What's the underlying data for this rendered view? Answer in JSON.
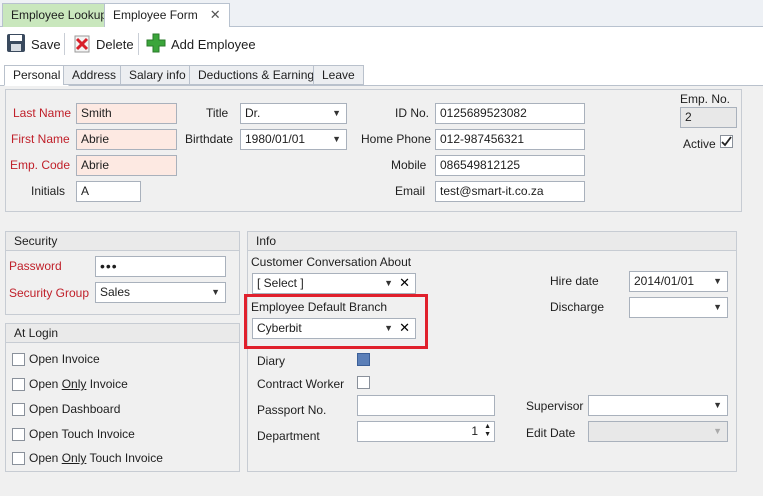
{
  "doc_tabs": [
    "Employee Lookup",
    "Employee Form"
  ],
  "toolbar": {
    "save": "Save",
    "delete": "Delete",
    "add": "Add Employee"
  },
  "tabs": [
    "Personal",
    "Address",
    "Salary info",
    "Deductions & Earnings",
    "Leave"
  ],
  "personal": {
    "last_name_label": "Last Name",
    "last_name": "Smith",
    "first_name_label": "First Name",
    "first_name": "Abrie",
    "emp_code_label": "Emp. Code",
    "emp_code": "Abrie",
    "initials_label": "Initials",
    "initials": "A",
    "title_label": "Title",
    "title": "Dr.",
    "birthdate_label": "Birthdate",
    "birthdate": "1980/01/01",
    "id_label": "ID No.",
    "id": "0125689523082",
    "home_phone_label": "Home Phone",
    "home_phone": "012-987456321",
    "mobile_label": "Mobile",
    "mobile": "086549812125",
    "email_label": "Email",
    "email": "test@smart-it.co.za",
    "emp_no_label": "Emp. No.",
    "emp_no": "2",
    "active_label": "Active"
  },
  "security": {
    "header": "Security",
    "password_label": "Password",
    "password": "•••",
    "group_label": "Security Group",
    "group": "Sales"
  },
  "login": {
    "header": "At Login",
    "items": [
      {
        "pre": "Open ",
        "u": "",
        "post": "Invoice"
      },
      {
        "pre": "Open ",
        "u": "Only",
        "post": " Invoice"
      },
      {
        "pre": "Open Dashboard",
        "u": "",
        "post": ""
      },
      {
        "pre": "Open Touch Invoice",
        "u": "",
        "post": ""
      },
      {
        "pre": "Open ",
        "u": "Only",
        "post": " Touch Invoice"
      }
    ]
  },
  "info": {
    "header": "Info",
    "conv_label": "Customer Conversation About",
    "conv": "[ Select ]",
    "branch_label": "Employee Default Branch",
    "branch": "Cyberbit",
    "hire_label": "Hire date",
    "hire": "2014/01/01",
    "discharge_label": "Discharge",
    "discharge": "",
    "diary_label": "Diary",
    "contract_label": "Contract Worker",
    "passport_label": "Passport No.",
    "passport": "",
    "dept_label": "Department",
    "dept": "1",
    "supervisor_label": "Supervisor",
    "supervisor": "",
    "edit_date_label": "Edit Date",
    "edit_date": ""
  },
  "colors": {
    "required_bg": "#fde9e2",
    "required_label": "#c0202a",
    "highlight": "#e0202c",
    "tab_green": "#c9e7bd"
  }
}
